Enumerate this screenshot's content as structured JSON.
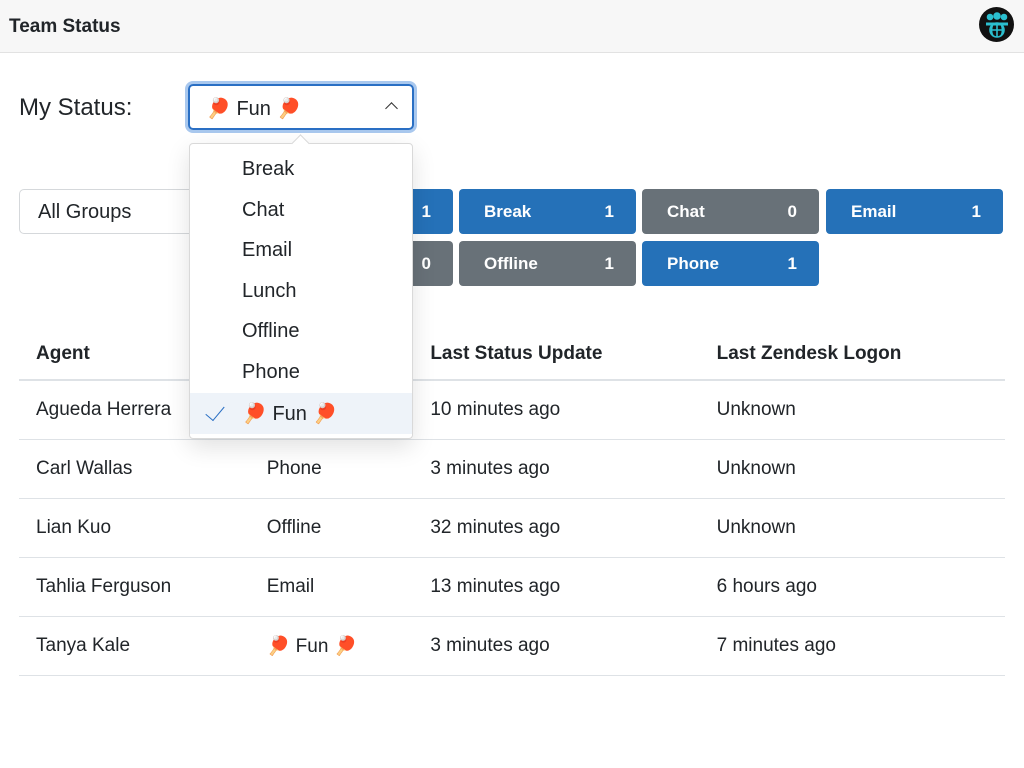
{
  "header": {
    "title": "Team Status",
    "logo_icon": "team-globe-icon"
  },
  "my_status": {
    "label": "My Status:",
    "value": "🏓 Fun 🏓",
    "options": [
      "Break",
      "Chat",
      "Email",
      "Lunch",
      "Offline",
      "Phone",
      "🏓 Fun 🏓"
    ],
    "selected": "🏓 Fun 🏓"
  },
  "groups": {
    "value": "All Groups"
  },
  "status_badges": [
    {
      "label": "",
      "count": "1",
      "color": "#2571b8"
    },
    {
      "label": "Break",
      "count": "1",
      "color": "#2571b8"
    },
    {
      "label": "Chat",
      "count": "0",
      "color": "#687178"
    },
    {
      "label": "Email",
      "count": "1",
      "color": "#2571b8"
    },
    {
      "label": "",
      "count": "0",
      "color": "#687178"
    },
    {
      "label": "Offline",
      "count": "1",
      "color": "#687178"
    },
    {
      "label": "Phone",
      "count": "1",
      "color": "#2571b8"
    }
  ],
  "table": {
    "headers": [
      "Agent",
      "",
      "Last Status Update",
      "Last Zendesk Logon"
    ],
    "rows": [
      [
        "Agueda Herrera",
        "",
        "10 minutes ago",
        "Unknown"
      ],
      [
        "Carl Wallas",
        "Phone",
        "3 minutes ago",
        "Unknown"
      ],
      [
        "Lian Kuo",
        "Offline",
        "32 minutes ago",
        "Unknown"
      ],
      [
        "Tahlia Ferguson",
        "Email",
        "13 minutes ago",
        "6 hours ago"
      ],
      [
        "Tanya Kale",
        "🏓 Fun 🏓",
        "3 minutes ago",
        "7 minutes ago"
      ]
    ]
  }
}
